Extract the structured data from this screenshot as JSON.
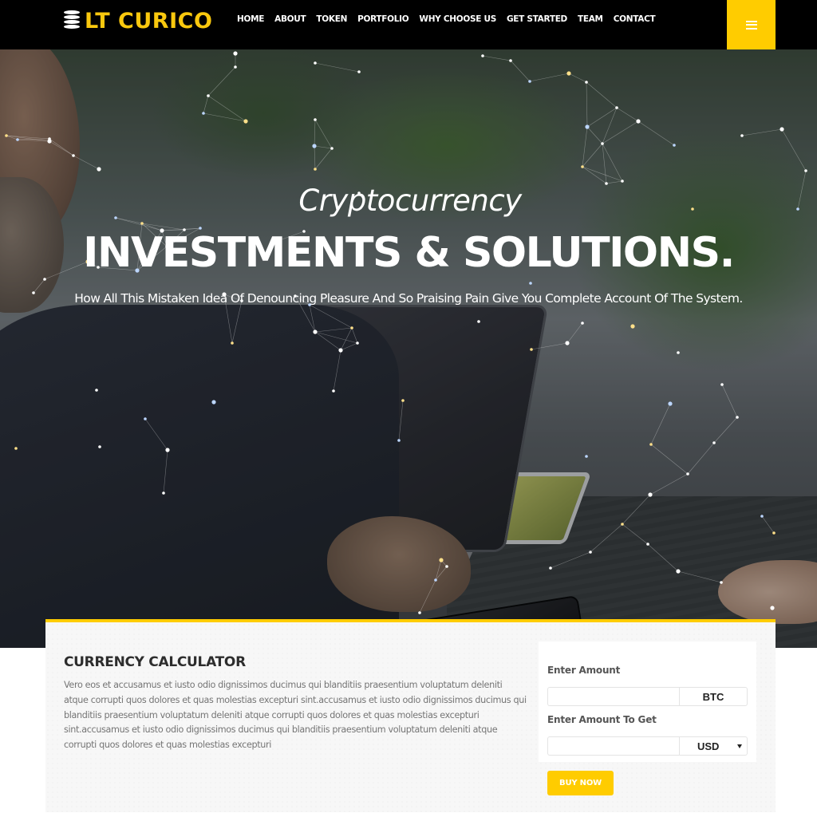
{
  "brand": {
    "name": "LT CURICO",
    "logo_icon": "coin-stack-icon",
    "accent_color": "#ffcc00"
  },
  "nav": {
    "items": [
      {
        "label": "HOME"
      },
      {
        "label": "ABOUT"
      },
      {
        "label": "TOKEN"
      },
      {
        "label": "PORTFOLIO"
      },
      {
        "label": "WHY CHOOSE US"
      },
      {
        "label": "GET STARTED"
      },
      {
        "label": "TEAM"
      },
      {
        "label": "CONTACT"
      }
    ],
    "menu_icon": "hamburger-menu-icon"
  },
  "hero": {
    "subtitle": "Cryptocurrency",
    "title": "INVESTMENTS & SOLUTIONS.",
    "description": "How All This Mistaken Idea Of Denouncing Pleasure And So Praising Pain Give You Complete Account Of The System."
  },
  "calculator": {
    "title": "CURRENCY CALCULATOR",
    "description": "Vero eos et accusamus et iusto odio dignissimos ducimus qui blanditiis praesentium voluptatum deleniti atque corrupti quos dolores et quas molestias excepturi sint.accusamus et iusto odio dignissimos ducimus qui blanditiis praesentium voluptatum deleniti atque corrupti quos dolores et quas molestias excepturi sint.accusamus et iusto odio dignissimos ducimus qui blanditiis praesentium voluptatum deleniti atque corrupti quos dolores et quas molestias excepturi",
    "amount_label": "Enter Amount",
    "amount_value": "",
    "amount_currency": "BTC",
    "get_label": "Enter Amount To Get",
    "get_value": "",
    "get_currency": "USD",
    "buy_label": "BUY NOW"
  }
}
